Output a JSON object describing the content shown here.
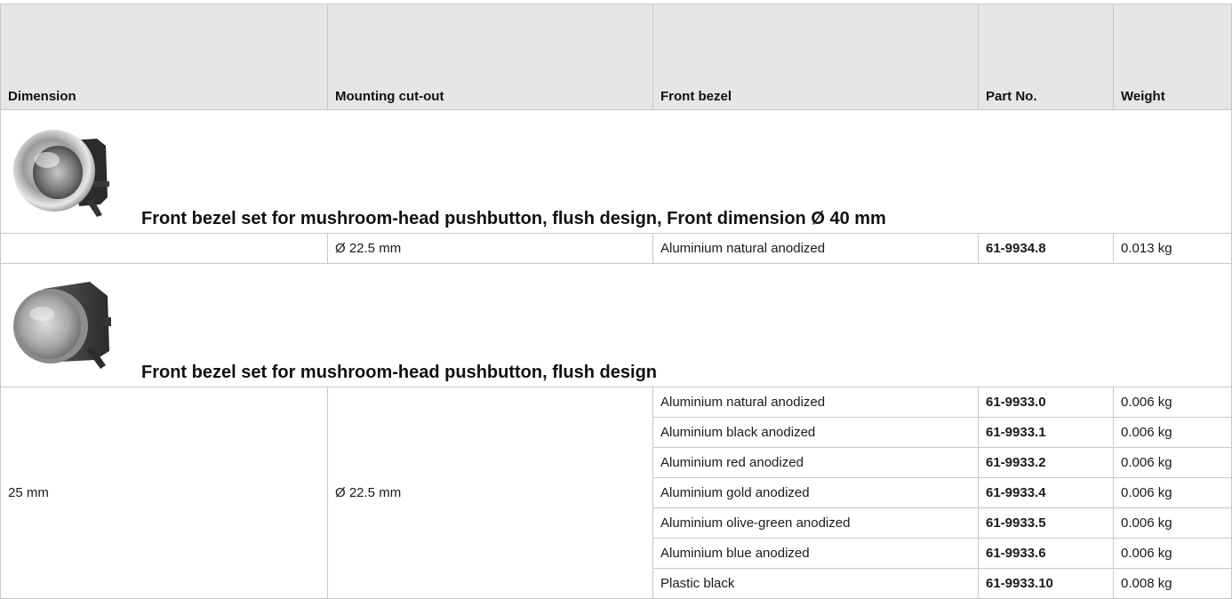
{
  "header": {
    "dimension": "Dimension",
    "mounting_cutout": "Mounting cut-out",
    "front_bezel": "Front bezel",
    "part_no": "Part No.",
    "weight": "Weight"
  },
  "sections": [
    {
      "title": "Front bezel set for mushroom-head pushbutton, flush design, Front dimension Ø 40 mm",
      "image_icon": "chrome-bezel-ring-image",
      "rows": [
        {
          "dimension": "",
          "cutout": "Ø 22.5 mm",
          "bezel": "Aluminium natural anodized",
          "part_no": "61-9934.8",
          "weight": "0.013 kg"
        }
      ]
    },
    {
      "title": "Front bezel set for mushroom-head pushbutton, flush design",
      "image_icon": "bezel-with-bracket-image",
      "dimension": "25 mm",
      "cutout": "Ø 22.5 mm",
      "rows": [
        {
          "bezel": "Aluminium natural anodized",
          "part_no": "61-9933.0",
          "weight": "0.006 kg"
        },
        {
          "bezel": "Aluminium black anodized",
          "part_no": "61-9933.1",
          "weight": "0.006 kg"
        },
        {
          "bezel": "Aluminium red anodized",
          "part_no": "61-9933.2",
          "weight": "0.006 kg"
        },
        {
          "bezel": "Aluminium gold anodized",
          "part_no": "61-9933.4",
          "weight": "0.006 kg"
        },
        {
          "bezel": "Aluminium olive-green anodized",
          "part_no": "61-9933.5",
          "weight": "0.006 kg"
        },
        {
          "bezel": "Aluminium blue anodized",
          "part_no": "61-9933.6",
          "weight": "0.006 kg"
        },
        {
          "bezel": "Plastic black",
          "part_no": "61-9933.10",
          "weight": "0.008 kg"
        }
      ]
    }
  ]
}
